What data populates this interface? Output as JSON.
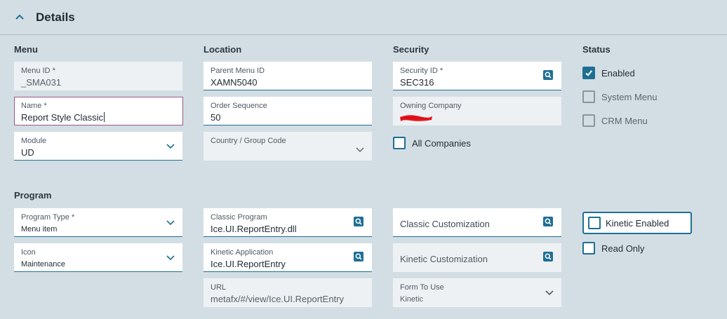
{
  "header": {
    "title": "Details",
    "icon": "chevron-up-icon"
  },
  "sections": {
    "menu": "Menu",
    "location": "Location",
    "security": "Security",
    "status": "Status",
    "program": "Program"
  },
  "fields": {
    "menu_id": {
      "label": "Menu ID *",
      "value": "_SMA031"
    },
    "name": {
      "label": "Name *",
      "value": "Report Style Classic"
    },
    "module": {
      "label": "Module",
      "value": "UD"
    },
    "parent_menu_id": {
      "label": "Parent Menu ID",
      "value": "XAMN5040"
    },
    "order_sequence": {
      "label": "Order Sequence",
      "value": "50"
    },
    "country_group_code": {
      "label": "Country / Group Code",
      "value": ""
    },
    "security_id": {
      "label": "Security ID *",
      "value": "SEC316"
    },
    "owning_company": {
      "label": "Owning Company",
      "value": ""
    },
    "program_type": {
      "label": "Program Type *",
      "value": "Menu item"
    },
    "icon": {
      "label": "Icon",
      "value": "Maintenance"
    },
    "classic_program": {
      "label": "Classic Program",
      "value": "Ice.UI.ReportEntry.dll"
    },
    "kinetic_application": {
      "label": "Kinetic Application",
      "value": "Ice.UI.ReportEntry"
    },
    "url": {
      "label": "URL",
      "value": "metafx/#/view/Ice.UI.ReportEntry"
    },
    "classic_customization": {
      "label": "Classic Customization"
    },
    "kinetic_customization": {
      "label": "Kinetic Customization"
    },
    "form_to_use": {
      "label": "Form To Use",
      "value": "Kinetic"
    }
  },
  "checkboxes": {
    "all_companies": {
      "label": "All Companies",
      "checked": false
    },
    "enabled": {
      "label": "Enabled",
      "checked": true
    },
    "system_menu": {
      "label": "System Menu",
      "checked": false
    },
    "crm_menu": {
      "label": "CRM Menu",
      "checked": false
    },
    "kinetic_enabled": {
      "label": "Kinetic Enabled",
      "checked": false
    },
    "read_only": {
      "label": "Read Only",
      "checked": false
    }
  },
  "colors": {
    "background": "#d3dee4",
    "accent": "#1f6f94",
    "field_bg": "#ffffff",
    "readonly_bg": "#eef1f3",
    "focus_border": "#9a5a86",
    "redaction": "#e8121c"
  }
}
